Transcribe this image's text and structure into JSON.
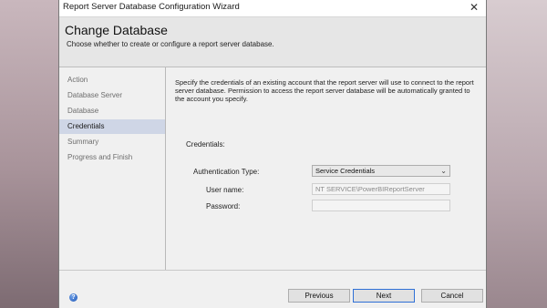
{
  "window": {
    "title": "Report Server Database Configuration Wizard",
    "close_glyph": "✕"
  },
  "header": {
    "title": "Change Database",
    "subtitle": "Choose whether to create or configure a report server database."
  },
  "nav": {
    "items": [
      {
        "label": "Action",
        "active": false
      },
      {
        "label": "Database Server",
        "active": false
      },
      {
        "label": "Database",
        "active": false
      },
      {
        "label": "Credentials",
        "active": true
      },
      {
        "label": "Summary",
        "active": false
      },
      {
        "label": "Progress and Finish",
        "active": false
      }
    ]
  },
  "main": {
    "description": "Specify the credentials of an existing account that the report server will use to connect to the report server database.  Permission to access the report server database will be automatically granted to the account you specify.",
    "credentials_heading": "Credentials:",
    "auth_type_label": "Authentication Type:",
    "auth_type_value": "Service Credentials",
    "username_label": "User name:",
    "username_value": "NT SERVICE\\PowerBIReportServer",
    "password_label": "Password:",
    "password_value": ""
  },
  "footer": {
    "help_icon": "help-icon",
    "previous_label": "Previous",
    "next_label": "Next",
    "cancel_label": "Cancel"
  },
  "colors": {
    "nav_active_bg": "#cfd6e6",
    "header_bg": "#e6e6e6",
    "primary_button_border": "#2f70d6"
  }
}
